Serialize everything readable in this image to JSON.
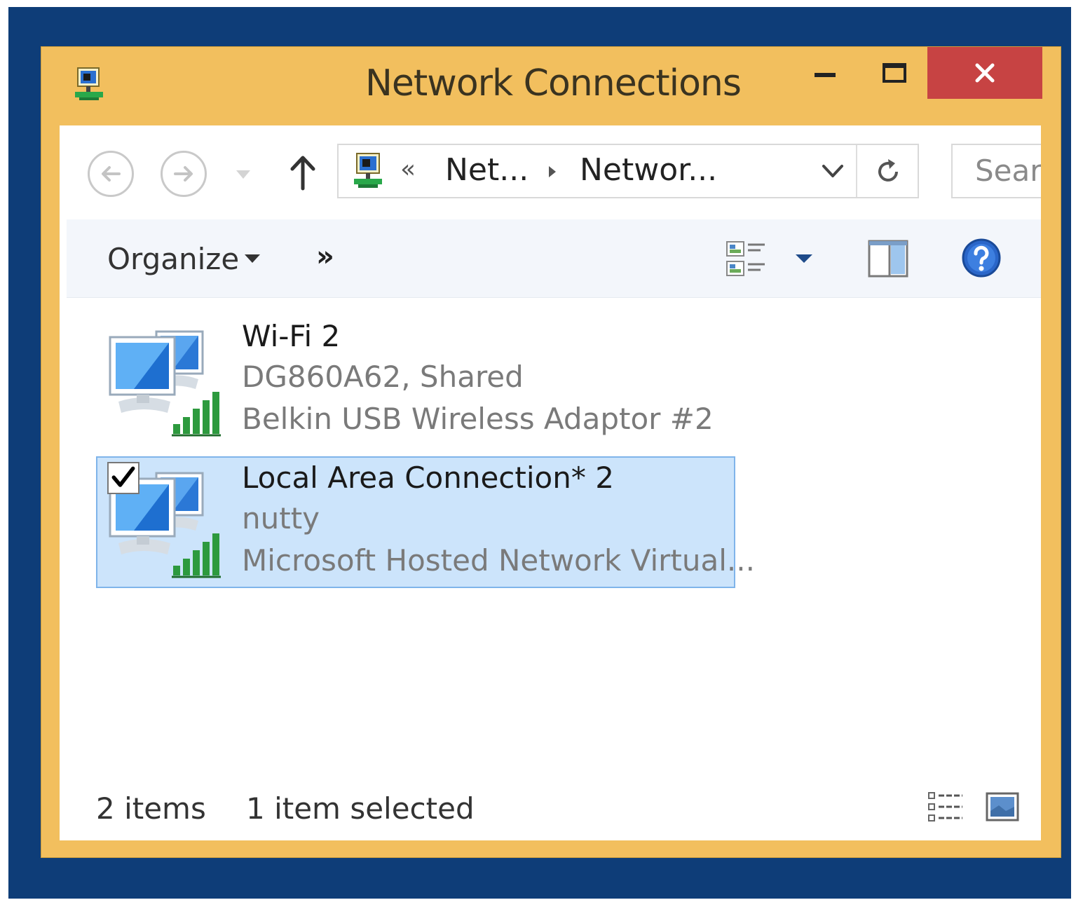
{
  "window": {
    "title": "Network Connections",
    "accent_color": "#f2bf5e",
    "close_color": "#c74343"
  },
  "address_bar": {
    "overflow_glyph": "«",
    "crumbs": [
      "Net...",
      "Networ..."
    ]
  },
  "search": {
    "placeholder": "Searc"
  },
  "command_bar": {
    "organize_label": "Organize",
    "more_label": "»"
  },
  "connections": [
    {
      "name": "Wi-Fi 2",
      "status": "DG860A62, Shared",
      "device": "Belkin USB Wireless Adaptor #2",
      "selected": false,
      "icon": "network-wifi-icon"
    },
    {
      "name": "Local Area Connection* 2",
      "status": "nutty",
      "device": "Microsoft Hosted Network Virtual...",
      "selected": true,
      "icon": "network-wifi-icon"
    }
  ],
  "status_bar": {
    "item_count": "2 items",
    "selection": "1 item selected"
  },
  "desktop_color": "#0e3d78",
  "selection_color": "#cce4fb"
}
